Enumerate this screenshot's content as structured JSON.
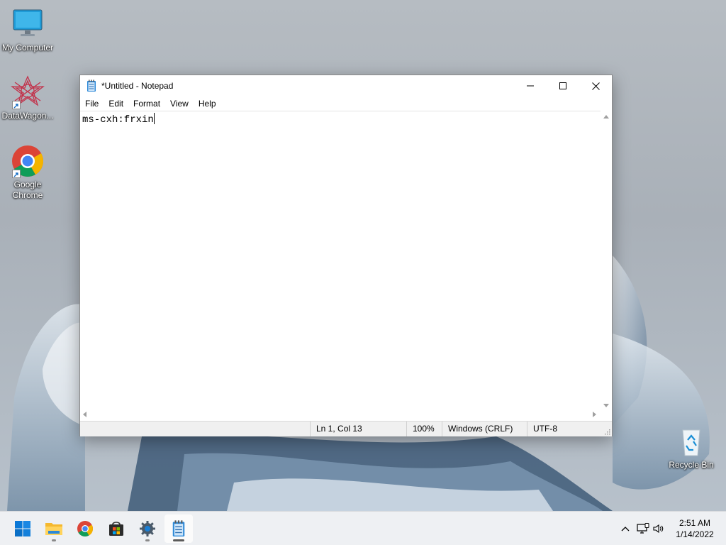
{
  "desktop": {
    "icons": [
      {
        "label": "My Computer"
      },
      {
        "label": "DataWagon..."
      },
      {
        "label": "Google Chrome"
      },
      {
        "label": "Recycle Bin"
      }
    ]
  },
  "notepad": {
    "title": "*Untitled - Notepad",
    "menu": [
      "File",
      "Edit",
      "Format",
      "View",
      "Help"
    ],
    "content": "ms-cxh:frxin",
    "status": {
      "position": "Ln 1, Col 13",
      "zoom": "100%",
      "line_ending": "Windows (CRLF)",
      "encoding": "UTF-8"
    }
  },
  "taskbar": {
    "apps": [
      {
        "name": "start-icon"
      },
      {
        "name": "file-explorer-icon"
      },
      {
        "name": "chrome-icon"
      },
      {
        "name": "store-icon"
      },
      {
        "name": "settings-icon"
      },
      {
        "name": "notepad-icon"
      }
    ],
    "clock": {
      "time": "2:51 AM",
      "date": "1/14/2022"
    }
  },
  "colors": {
    "accent": "#0067c0",
    "chrome_red": "#db4437",
    "chrome_yellow": "#f4b400",
    "chrome_green": "#0f9d58",
    "chrome_blue": "#4285f4"
  }
}
